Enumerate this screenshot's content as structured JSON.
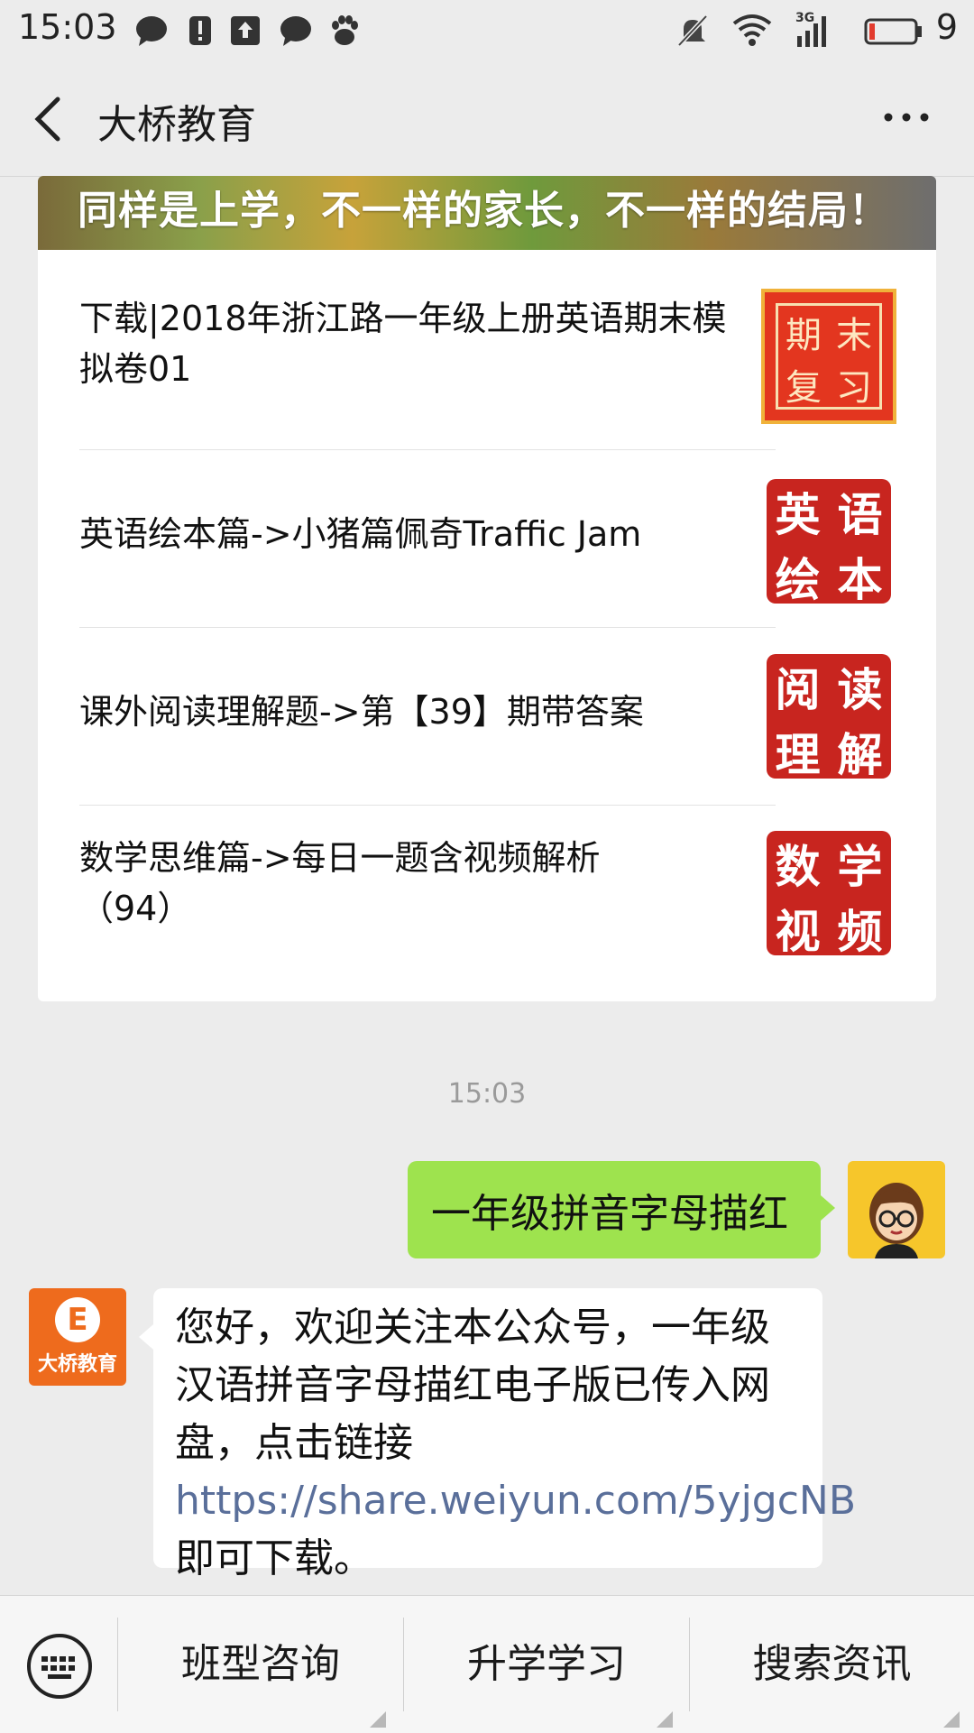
{
  "status_bar": {
    "time": "15:03",
    "network": "3G",
    "battery_level": "9",
    "icons": [
      "chat-bubble-icon",
      "alert-icon",
      "upload-icon",
      "chat-bubble-icon",
      "baidu-paw-icon",
      "mute-bell-icon",
      "wifi-icon",
      "signal-icon",
      "battery-icon"
    ]
  },
  "nav": {
    "title": "大桥教育",
    "back_icon": "chevron-left-icon",
    "more_icon": "more-dots-icon"
  },
  "card": {
    "banner_text": "同样是上学，不一样的家长，不一样的结局！",
    "articles": [
      {
        "title": "下载|2018年浙江路一年级上册英语期末模拟卷01",
        "thumb_chars": [
          "期",
          "末",
          "复",
          "习"
        ]
      },
      {
        "title": "英语绘本篇->小猪篇佩奇Traffic Jam",
        "thumb_chars": [
          "英",
          "语",
          "绘",
          "本"
        ]
      },
      {
        "title": "课外阅读理解题->第【39】期带答案",
        "thumb_chars": [
          "阅",
          "读",
          "理",
          "解"
        ]
      },
      {
        "title": "数学思维篇->每日一题含视频解析（94）",
        "thumb_chars": [
          "数",
          "学",
          "视",
          "频"
        ]
      }
    ]
  },
  "chat": {
    "timestamp": "15:03",
    "user_message": "一年级拼音字母描红",
    "reply_text_before_link": "您好，欢迎关注本公众号，一年级汉语拼音字母描红电子版已传入网盘，点击链接",
    "reply_link": "https://share.weiyun.com/5yjgcNB",
    "reply_text_after_link": " 即可下载。",
    "brand_logo_letter": "E",
    "brand_logo_text": "大桥教育"
  },
  "menu": {
    "items": [
      "班型咨询",
      "升学学习",
      "搜索资讯"
    ]
  },
  "colors": {
    "background": "#ececec",
    "user_bubble": "#9ee34e",
    "link": "#5a6f9a",
    "brand_orange": "#ee6b1d",
    "stamp_red": "#c8251f"
  }
}
